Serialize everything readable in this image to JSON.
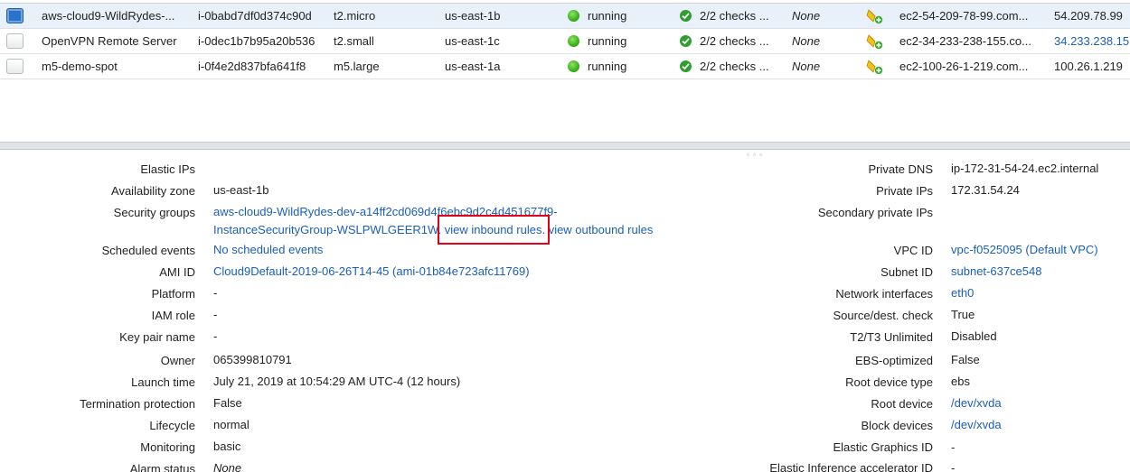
{
  "instances": [
    {
      "name": "aws-cloud9-WildRydes-...",
      "id": "i-0babd7df0d374c90d",
      "type": "t2.micro",
      "az": "us-east-1b",
      "state": "running",
      "status_checks": "2/2 checks ...",
      "alarm_status": "None",
      "public_dns": "ec2-54-209-78-99.com...",
      "public_ip": "54.209.78.99",
      "selected": true
    },
    {
      "name": "OpenVPN Remote Server",
      "id": "i-0dec1b7b95a20b536",
      "type": "t2.small",
      "az": "us-east-1c",
      "state": "running",
      "status_checks": "2/2 checks ...",
      "alarm_status": "None",
      "public_dns": "ec2-34-233-238-155.co...",
      "public_ip": "34.233.238.15",
      "selected": false
    },
    {
      "name": "m5-demo-spot",
      "id": "i-0f4e2d837bfa641f8",
      "type": "m5.large",
      "az": "us-east-1a",
      "state": "running",
      "status_checks": "2/2 checks ...",
      "alarm_status": "None",
      "public_dns": "ec2-100-26-1-219.com...",
      "public_ip": "100.26.1.219",
      "selected": false
    }
  ],
  "colors": {
    "running": "#3fb51d",
    "link": "#1a5fb4",
    "highlight": "#e3001b",
    "selected_row": "#e8f1fa"
  },
  "splitter_grip": "▫ ▫ ▫",
  "details": {
    "elastic_ips": {
      "label": "Elastic IPs",
      "value": ""
    },
    "availability_zone": {
      "label": "Availability zone",
      "value": "us-east-1b"
    },
    "security_groups": {
      "label": "Security groups",
      "line1": "aws-cloud9-WildRydes-dev-a14ff2cd069d4f6ebc9d2c4d451677f9-",
      "line2": "InstanceSecurityGroup-WSLPWLGEER1W",
      "sep1": ". ",
      "inbound": "view inbound rules",
      "sep2": ". ",
      "outbound": "view outbound rules"
    },
    "scheduled_events": {
      "label": "Scheduled events",
      "value": "No scheduled events"
    },
    "ami_id": {
      "label": "AMI ID",
      "value": "Cloud9Default-2019-06-26T14-45 (ami-01b84e723afc11769)"
    },
    "platform": {
      "label": "Platform",
      "value": "-"
    },
    "iam_role": {
      "label": "IAM role",
      "value": "-"
    },
    "key_pair_name": {
      "label": "Key pair name",
      "value": "-"
    },
    "owner": {
      "label": "Owner",
      "value": "065399810791"
    },
    "launch_time": {
      "label": "Launch time",
      "value": "July 21, 2019 at 10:54:29 AM UTC-4 (12 hours)"
    },
    "termination_protection": {
      "label": "Termination protection",
      "value": "False"
    },
    "lifecycle": {
      "label": "Lifecycle",
      "value": "normal"
    },
    "monitoring": {
      "label": "Monitoring",
      "value": "basic"
    },
    "alarm_status": {
      "label": "Alarm status",
      "value": "None"
    },
    "private_dns": {
      "label": "Private DNS",
      "value": "ip-172-31-54-24.ec2.internal"
    },
    "private_ips": {
      "label": "Private IPs",
      "value": "172.31.54.24"
    },
    "secondary_private_ips": {
      "label": "Secondary private IPs",
      "value": ""
    },
    "vpc_id": {
      "label": "VPC ID",
      "value": "vpc-f0525095 (Default VPC)"
    },
    "subnet_id": {
      "label": "Subnet ID",
      "value": "subnet-637ce548"
    },
    "network_interfaces": {
      "label": "Network interfaces",
      "value": "eth0"
    },
    "source_dest_check": {
      "label": "Source/dest. check",
      "value": "True"
    },
    "t2_t3_unlimited": {
      "label": "T2/T3 Unlimited",
      "value": "Disabled"
    },
    "ebs_optimized": {
      "label": "EBS-optimized",
      "value": "False"
    },
    "root_device_type": {
      "label": "Root device type",
      "value": "ebs"
    },
    "root_device": {
      "label": "Root device",
      "value": "/dev/xvda"
    },
    "block_devices": {
      "label": "Block devices",
      "value": "/dev/xvda"
    },
    "elastic_graphics_id": {
      "label": "Elastic Graphics ID",
      "value": "-"
    },
    "elastic_inference_accelerator_id": {
      "label": "Elastic Inference accelerator ID",
      "value": "-"
    }
  }
}
